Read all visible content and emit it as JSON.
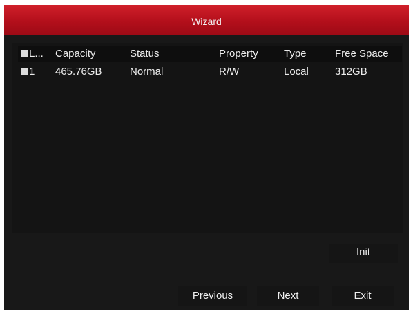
{
  "window": {
    "title": "Wizard"
  },
  "table": {
    "columns": [
      "L...",
      "Capacity",
      "Status",
      "Property",
      "Type",
      "Free Space"
    ],
    "rows": [
      [
        "1",
        "465.76GB",
        "Normal",
        "R/W",
        "Local",
        "312GB"
      ]
    ]
  },
  "buttons": {
    "init": "Init",
    "previous": "Previous",
    "next": "Next",
    "exit": "Exit"
  },
  "colors": {
    "title_bar": "#b30f1b",
    "background": "#181818"
  }
}
